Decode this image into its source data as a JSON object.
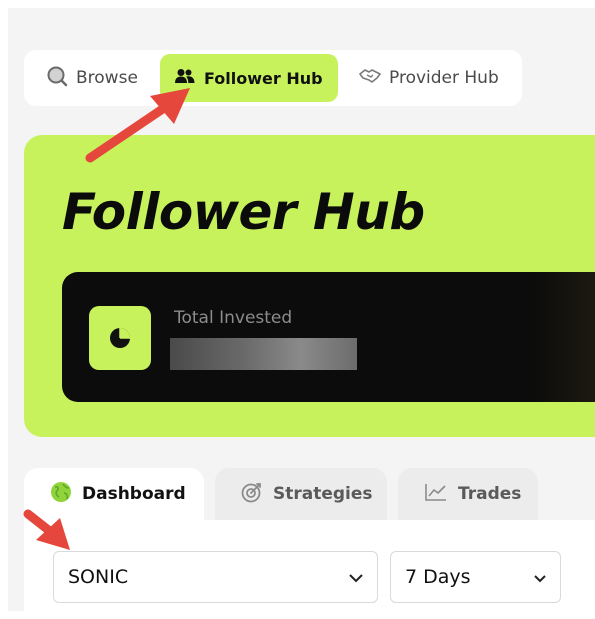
{
  "hub_tabs": {
    "browse": "Browse",
    "follower": "Follower Hub",
    "provider": "Provider Hub"
  },
  "hero": {
    "title": "Follower Hub",
    "total_invested_label": "Total Invested"
  },
  "section_tabs": {
    "dashboard": "Dashboard",
    "strategies": "Strategies",
    "trades": "Trades"
  },
  "filters": {
    "network": "SONIC",
    "period": "7 Days"
  },
  "colors": {
    "accent": "#c7f25c",
    "card": "#0c0c0c",
    "annotation_arrow": "#e5473c"
  },
  "icons": [
    "search-icon",
    "users-icon",
    "handshake-icon",
    "pie-chart-icon",
    "globe-icon",
    "target-icon",
    "trend-chart-icon",
    "chevron-down-icon",
    "annotation-arrow"
  ]
}
